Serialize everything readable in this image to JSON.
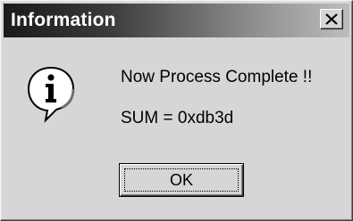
{
  "dialog": {
    "title": "Information",
    "message": "Now Process Complete !!",
    "detail": "SUM = 0xdb3d",
    "ok_label": "OK",
    "icon": "information-icon"
  }
}
